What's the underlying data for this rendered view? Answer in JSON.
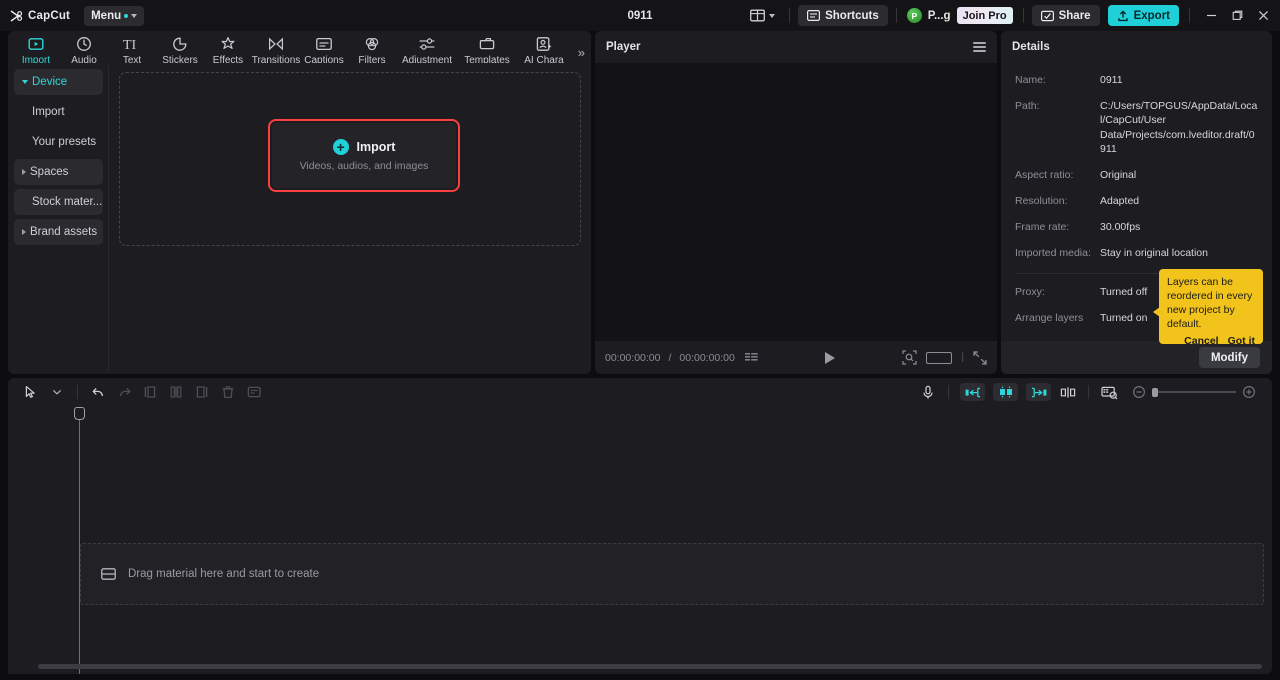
{
  "titlebar": {
    "brand": "CapCut",
    "menu_label": "Menu",
    "project_title": "0911",
    "layout_icon": "layout-grid-icon",
    "shortcuts_label": "Shortcuts",
    "avatar_initial": "P",
    "username": "P...g",
    "join_pro_label": "Join Pro",
    "share_label": "Share",
    "export_label": "Export",
    "minimize_label": "−",
    "maximize_label": "❐",
    "close_label": "✕",
    "accent_color": "#1fd0d8"
  },
  "tabs": [
    {
      "label": "Import",
      "icon": "import-icon",
      "active": true
    },
    {
      "label": "Audio",
      "icon": "audio-icon",
      "active": false
    },
    {
      "label": "Text",
      "icon": "text-icon",
      "active": false
    },
    {
      "label": "Stickers",
      "icon": "stickers-icon",
      "active": false
    },
    {
      "label": "Effects",
      "icon": "effects-icon",
      "active": false
    },
    {
      "label": "Transitions",
      "icon": "transitions-icon",
      "active": false
    },
    {
      "label": "Captions",
      "icon": "captions-icon",
      "active": false
    },
    {
      "label": "Filters",
      "icon": "filters-icon",
      "active": false
    },
    {
      "label": "Adjustment",
      "icon": "adjustment-icon",
      "active": false
    },
    {
      "label": "Templates",
      "icon": "templates-icon",
      "active": false
    },
    {
      "label": "AI Chara",
      "icon": "ai-character-icon",
      "active": false
    }
  ],
  "tabs_overflow": "»",
  "sidebar": {
    "items": [
      {
        "label": "Device",
        "type": "group",
        "selected": true,
        "expanded": true
      },
      {
        "label": "Import",
        "type": "sub",
        "selected": false
      },
      {
        "label": "Your presets",
        "type": "sub",
        "selected": false
      },
      {
        "label": "Spaces",
        "type": "group",
        "selected": false,
        "expanded": false
      },
      {
        "label": "Stock mater...",
        "type": "plain",
        "selected": false
      },
      {
        "label": "Brand assets",
        "type": "group",
        "selected": false,
        "expanded": false
      }
    ]
  },
  "import_box": {
    "title": "Import",
    "subtitle": "Videos, audios, and images",
    "plus_glyph": "+",
    "highlight_color": "#f8403e"
  },
  "player": {
    "title": "Player",
    "menu_icon": "hamburger-icon",
    "current_time": "00:00:00:00",
    "total_time": "00:00:00:00",
    "time_separator": "/",
    "play_icon": "play-icon",
    "quality_icon": "quality-icon",
    "ratio_icon": "aspect-ratio-icon",
    "fullscreen_icon": "fullscreen-icon"
  },
  "details": {
    "title": "Details",
    "rows": [
      {
        "key": "Name:",
        "value": "0911"
      },
      {
        "key": "Path:",
        "value": "C:/Users/TOPGUS/AppData/Local/CapCut/User Data/Projects/com.lveditor.draft/0911"
      },
      {
        "key": "Aspect ratio:",
        "value": "Original"
      },
      {
        "key": "Resolution:",
        "value": "Adapted"
      },
      {
        "key": "Frame rate:",
        "value": "30.00fps"
      },
      {
        "key": "Imported media:",
        "value": "Stay in original location"
      }
    ],
    "rows2": [
      {
        "key": "Proxy:",
        "value": "Turned off"
      },
      {
        "key": "Arrange layers",
        "value": "Turned on"
      }
    ],
    "modify_label": "Modify"
  },
  "tooltip": {
    "text": "Layers can be reordered in every new project by default.",
    "cancel_label": "Cancel",
    "confirm_label": "Got it",
    "background": "#f2c41b"
  },
  "timeline": {
    "tools": [
      {
        "icon": "select-cursor-icon",
        "dim": false
      },
      {
        "icon": "chevron-down-icon",
        "dim": false
      },
      {
        "icon": "undo-icon",
        "dim": false
      },
      {
        "icon": "redo-icon",
        "dim": true
      },
      {
        "icon": "split-left-icon",
        "dim": true
      },
      {
        "icon": "split-icon",
        "dim": true
      },
      {
        "icon": "split-right-icon",
        "dim": true
      },
      {
        "icon": "delete-icon",
        "dim": true
      },
      {
        "icon": "crop-icon",
        "dim": true
      }
    ],
    "right_tools": [
      {
        "icon": "microphone-icon",
        "active": false
      },
      {
        "icon": "snap-left-icon",
        "active": true
      },
      {
        "icon": "auto-snap-icon",
        "active": true
      },
      {
        "icon": "snap-right-icon",
        "active": true
      },
      {
        "icon": "mirror-icon",
        "active": false
      },
      {
        "icon": "preview-thumb-icon",
        "active": false
      }
    ],
    "zoom_out_icon": "zoom-out-icon",
    "zoom_in_icon": "zoom-in-icon",
    "drop_hint": "Drag material here and start to create",
    "drop_icon": "track-icon"
  }
}
